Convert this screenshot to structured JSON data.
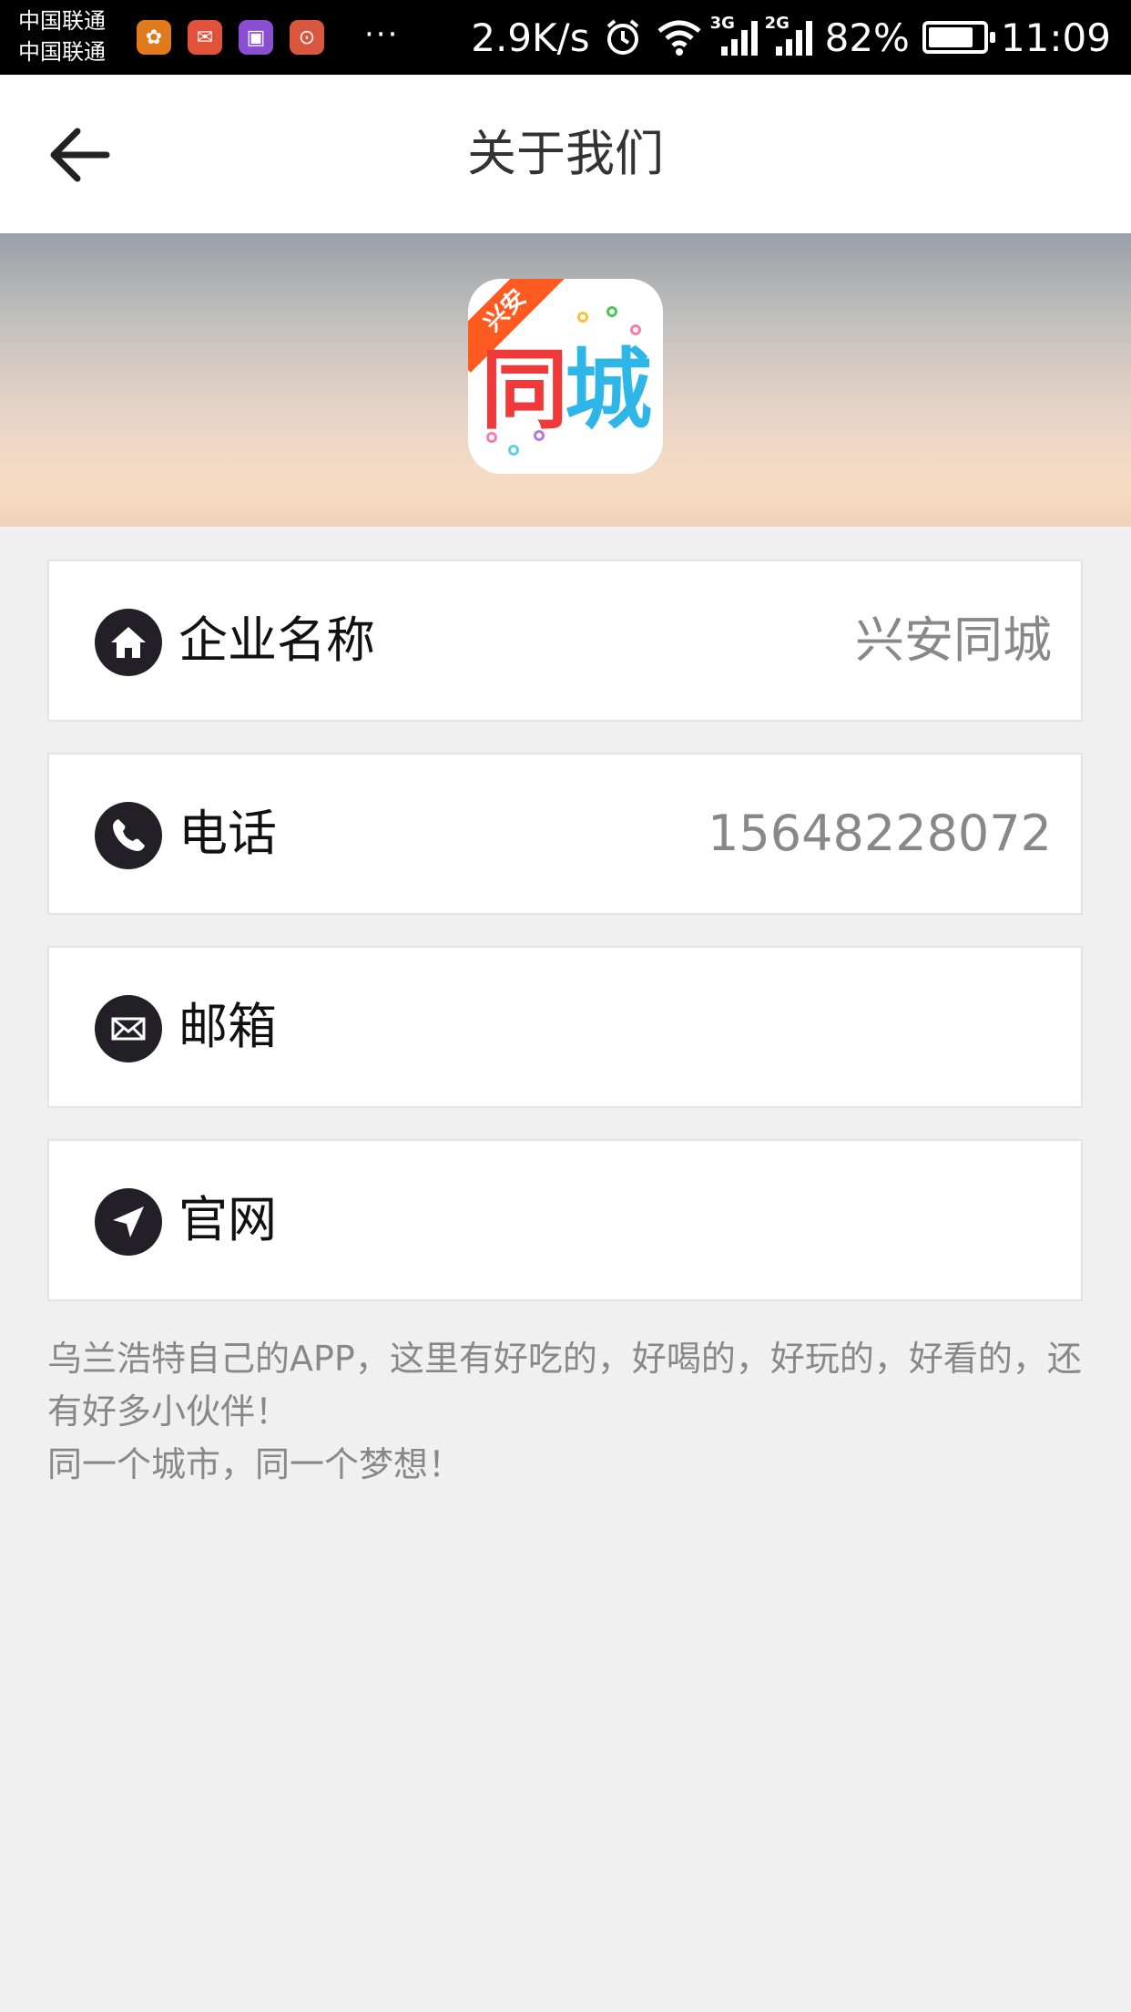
{
  "status_bar": {
    "carrier_1": "中国联通",
    "carrier_2": "中国联通",
    "more": "···",
    "speed": "2.9K/s",
    "net_3g": "3G",
    "net_2g": "2G",
    "battery": "82%",
    "battery_level": 0.82,
    "time": "11:09"
  },
  "header": {
    "title": "关于我们"
  },
  "banner": {
    "ribbon_text": "兴安",
    "logo_char_1": "同",
    "logo_char_2": "城"
  },
  "items": [
    {
      "label": "企业名称",
      "value": "兴安同城",
      "icon": "home-icon"
    },
    {
      "label": "电话",
      "value": "15648228072",
      "icon": "phone-icon"
    },
    {
      "label": "邮箱",
      "value": "",
      "icon": "mail-icon"
    },
    {
      "label": "官网",
      "value": "",
      "icon": "navigation-icon"
    }
  ],
  "description": {
    "line_1": "乌兰浩特自己的APP，这里有好吃的，好喝的，好玩的，好看的，还有好多小伙伴！",
    "line_2": "同一个城市，同一个梦想！"
  },
  "colors": {
    "accent_orange": "#ff5a1f",
    "logo_red": "#f03a3a",
    "logo_blue": "#2eb6e8",
    "icon_dark": "#231f26"
  }
}
